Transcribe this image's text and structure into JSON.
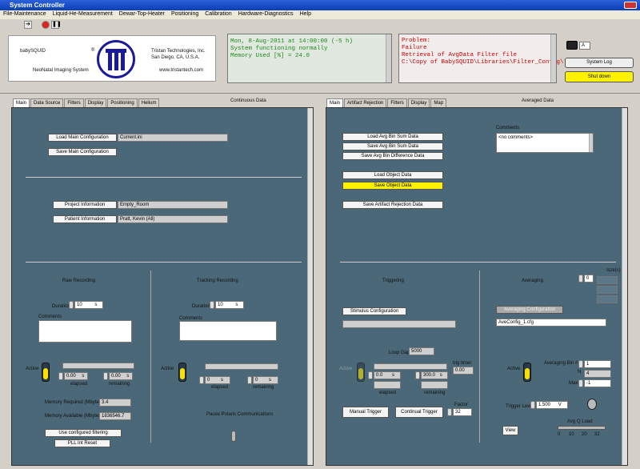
{
  "window": {
    "title": "System Controller"
  },
  "menu": [
    "File-Maintenance",
    "Liquid-He-Measurement",
    "Dewar-Top-Heater",
    "Positioning",
    "Calibration",
    "Hardware-Diagnostics",
    "Help"
  ],
  "logo": {
    "product": "babySQUID",
    "subtitle": "NeoNatal Imaging System",
    "company": "Tristan Technologies, Inc.",
    "city": "San Diego, CA, U.S.A.",
    "url": "www.tristantech.com"
  },
  "status": {
    "lines": [
      "Mon, 8-Aug-2011 at 14:00:00 (-5 h)",
      "System functioning normally",
      "Memory Used [%] = 24.0"
    ]
  },
  "problem": {
    "lines": [
      "Problem:",
      "Failure",
      "Retrieval of AvgData Filter file",
      "C:\\Copy of BabySQUID\\Libraries\\Filter_Config\\*"
    ]
  },
  "camera": {
    "label": "A"
  },
  "buttons": {
    "system_log": "System Log",
    "shutdown": "Shut down"
  },
  "left": {
    "heading": "Continuous Data",
    "tabs": [
      "Main",
      "Data Source",
      "Filters",
      "Display",
      "Positioning",
      "Helium"
    ],
    "load_main": "Load Main Configuration",
    "config_file": "Current.ini",
    "save_main": "Save Main Configuration",
    "project_info": "Project Information",
    "project_value": "Empty_Room",
    "patient_info": "Patient Information",
    "patient_value": "Pratt, Kevin (All)",
    "raw": {
      "title": "Raw Recording",
      "duration_label": "Duration",
      "duration": "10",
      "unit": "s",
      "comments": "Comments",
      "active": "Active",
      "elapsed_val": "0.00",
      "remaining_val": "0.00",
      "elapsed": "elapsed",
      "remaining": "remaining"
    },
    "tracking": {
      "title": "Tracking Recording",
      "duration_label": "Duration",
      "duration": "10",
      "unit": "s",
      "comments": "Comments",
      "active": "Active",
      "elapsed_val": "0",
      "remaining_val": "0",
      "elapsed": "elapsed",
      "remaining": "remaining"
    },
    "mem_req_label": "Memory Required (Mbytes)",
    "mem_req": "3.4",
    "mem_avail_label": "Memory Available (Mbytes)",
    "mem_avail": "1836546.7",
    "use_filter": "Use configured filtering",
    "pll_reset": "PLL Int Reset",
    "pause": "Pause Polaris Communications"
  },
  "right": {
    "heading": "Averaged Data",
    "tabs": [
      "Main",
      "Artifact Rejection",
      "Filters",
      "Display",
      "Map"
    ],
    "load_avg": "Load Avg Bin Sum Data",
    "save_avg": "Save Avg Bin Sum Data",
    "save_diff": "Save Avg Bin Difference Data",
    "load_obj": "Load Object Data",
    "save_obj": "Save Object Data",
    "save_art": "Save Artifact Rejection Data",
    "comments": "Comments",
    "comments_value": "<no comments>",
    "triggering": "Triggering",
    "stimulus": "Stimulus Configuration",
    "loop_gap_label": "Loop Gap",
    "loop_gap": "5000",
    "trig_timer_label": "trig timer",
    "trig_timer": "0.00",
    "active": "Active",
    "elapsed_val": "0.0",
    "remaining_val": "300.0",
    "elapsed": "elapsed",
    "remaining": "remaining",
    "manual": "Manual Trigger",
    "continual": "Continual Trigger",
    "factor_label": "Factor",
    "factor": "32",
    "averaging": "Averaging",
    "avg_config": "Averaging Configuration",
    "avg_file": "AveConfig_1.cfg",
    "size_label": "size(s)",
    "size_val": "0",
    "bin_label": "Averaging Bin #",
    "bin": "1",
    "n_label": "N",
    "n": "4",
    "max_label": "Max",
    "max": "-1",
    "trig_level_label": "Trigger Level",
    "trig_level": "1.500",
    "trig_unit": "V",
    "view": "View",
    "q_load": "Avg Q Load",
    "q_ticks": [
      "0",
      "10",
      "20",
      "32"
    ]
  }
}
